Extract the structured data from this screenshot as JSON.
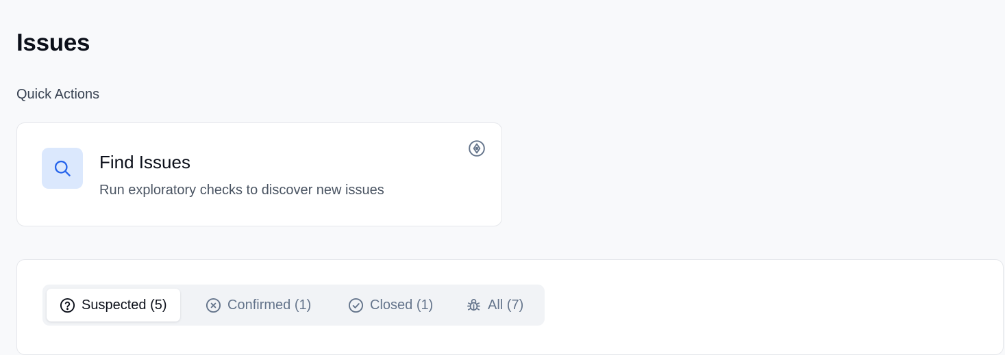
{
  "page": {
    "title": "Issues"
  },
  "quick_actions": {
    "label": "Quick Actions",
    "cards": [
      {
        "title": "Find Issues",
        "description": "Run exploratory checks to discover new issues",
        "icon": "search-icon",
        "corner_icon": "compass-icon"
      }
    ]
  },
  "tabs": [
    {
      "label": "Suspected (5)",
      "icon": "question-circle-icon",
      "active": true
    },
    {
      "label": "Confirmed (1)",
      "icon": "x-circle-icon",
      "active": false
    },
    {
      "label": "Closed (1)",
      "icon": "check-circle-icon",
      "active": false
    },
    {
      "label": "All (7)",
      "icon": "bug-icon",
      "active": false
    }
  ],
  "colors": {
    "accent": "#2563eb",
    "accent_bg": "#dbe8fd",
    "page_bg": "#f8f9fb",
    "muted_text": "#64748b"
  }
}
